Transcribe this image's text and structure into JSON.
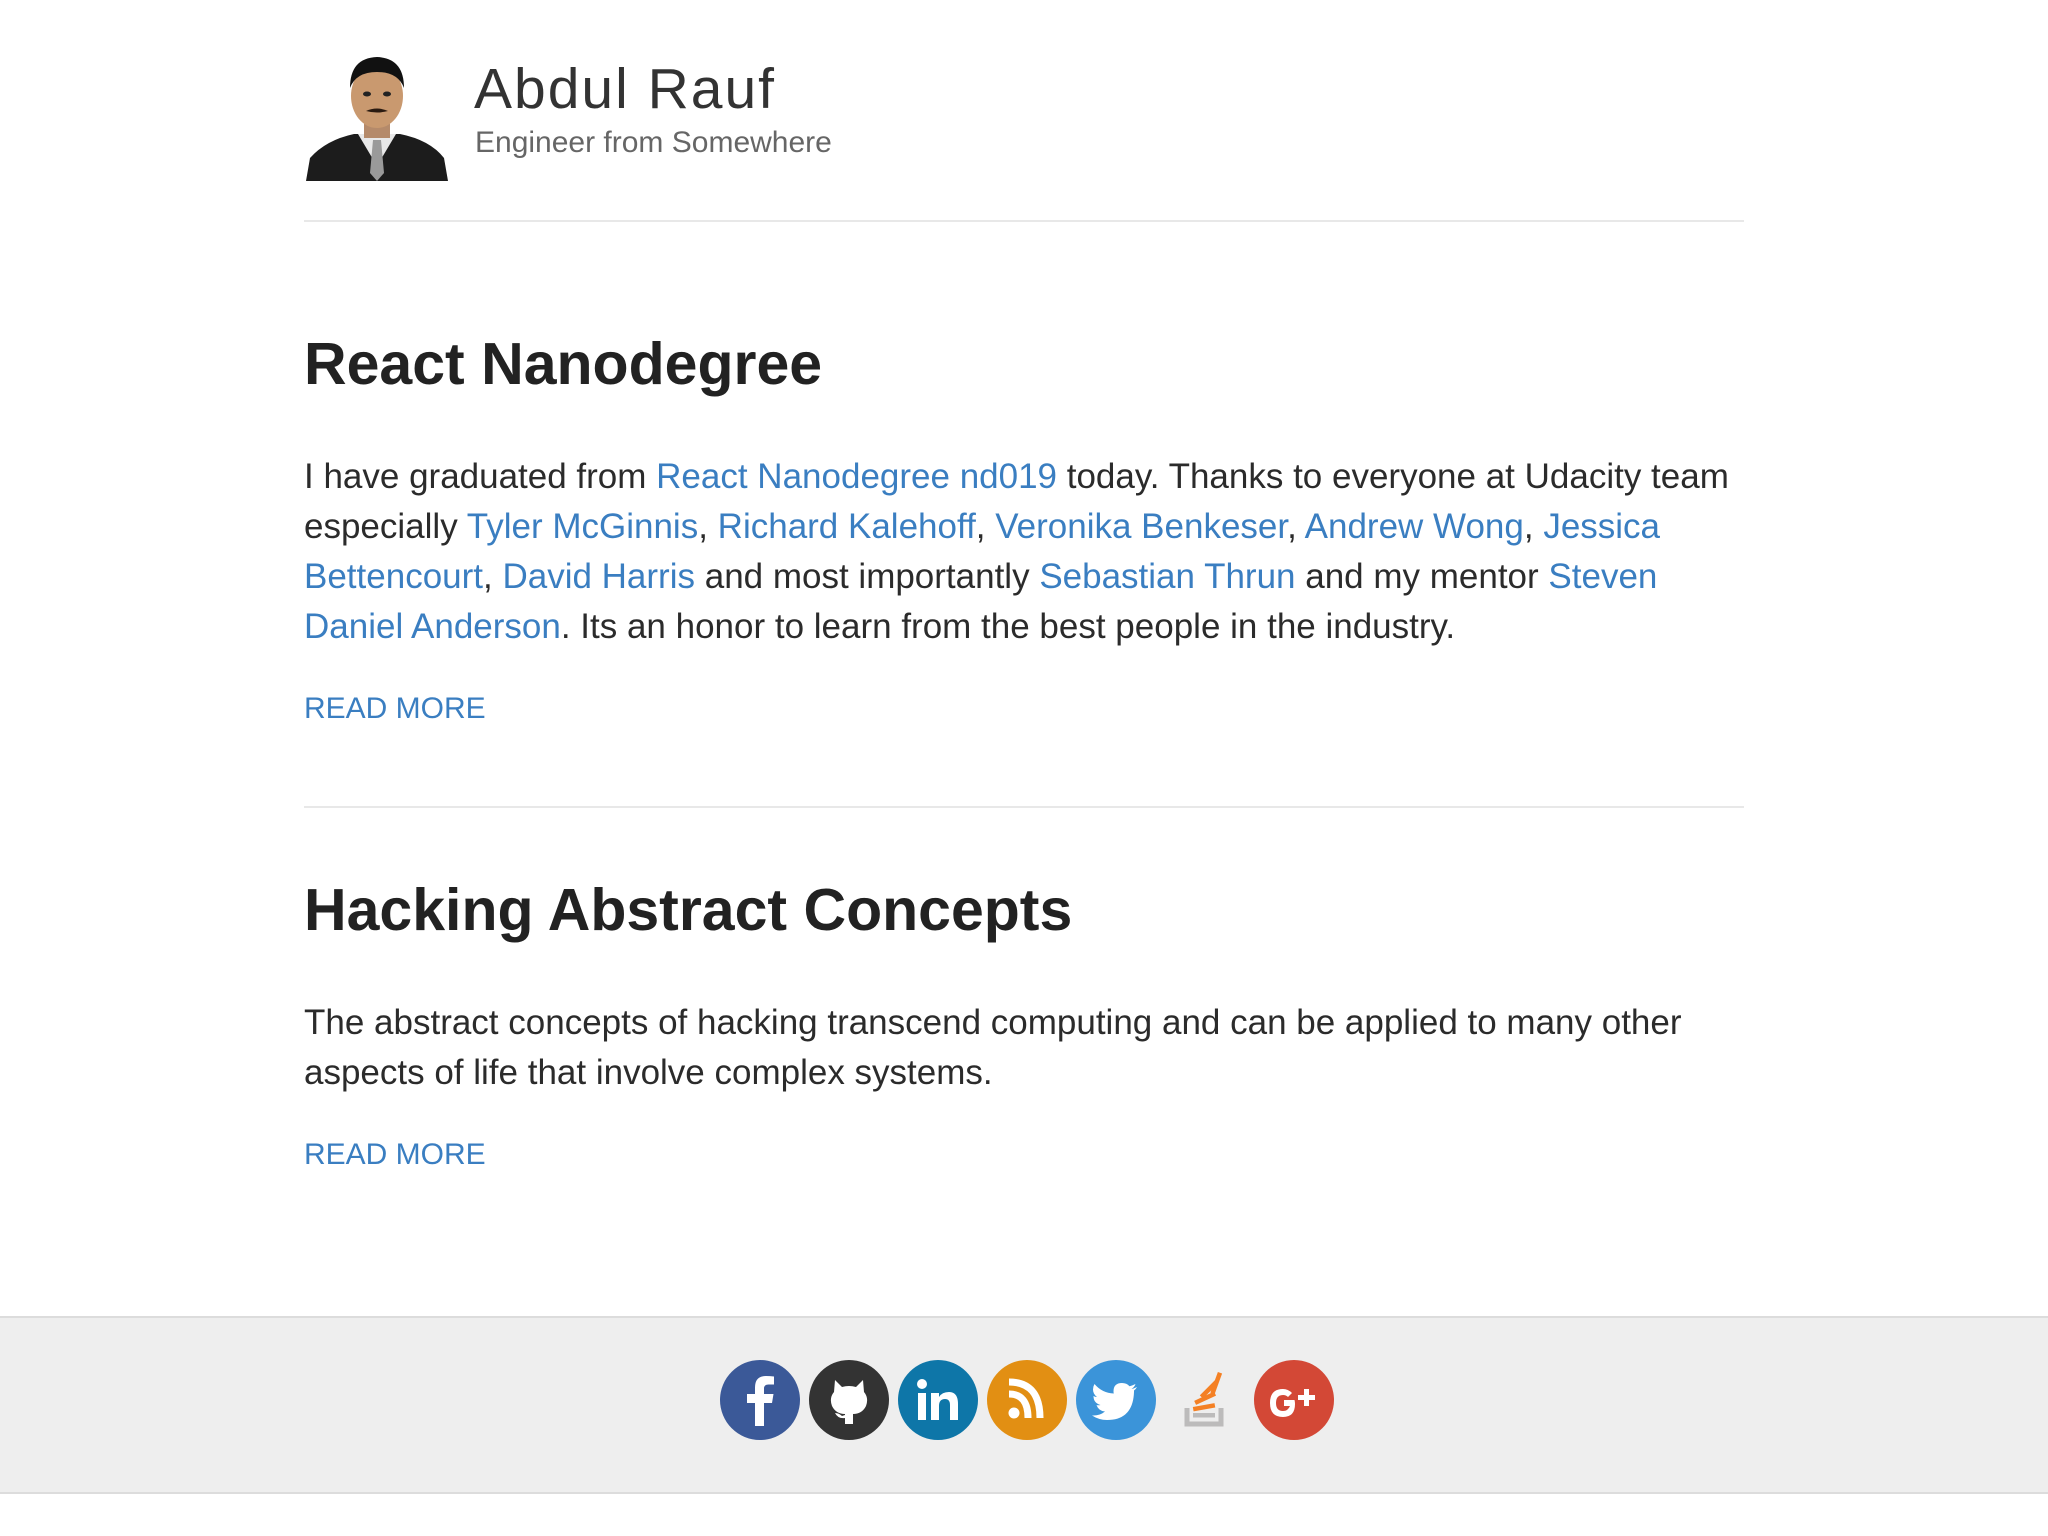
{
  "header": {
    "name": "Abdul Rauf",
    "tagline": "Engineer from Somewhere"
  },
  "posts": [
    {
      "title": "React Nanodegree",
      "body": {
        "t1": "I have graduated from ",
        "link_nd": "React Nanodegree nd019",
        "t2": " today. Thanks to everyone at Udacity team especially ",
        "link_tyler": "Tyler McGinnis",
        "sep1": ", ",
        "link_richard": "Richard Kalehoff",
        "sep2": ", ",
        "link_veronika": "Veronika Benkeser",
        "sep3": ", ",
        "link_andrew": "Andrew Wong",
        "sep4": ", ",
        "link_jessica": "Jessica Bettencourt",
        "sep5": ", ",
        "link_david": "David Harris",
        "t3": " and most importantly ",
        "link_sebastian": "Sebastian Thrun",
        "t4": " and my mentor ",
        "link_steven": "Steven Daniel Anderson",
        "t5": ". Its an honor to learn from the best people in the industry."
      },
      "read_more": "READ MORE"
    },
    {
      "title": "Hacking Abstract Concepts",
      "body": "The abstract concepts of hacking transcend computing and can be applied to many other aspects of life that involve complex systems.",
      "read_more": "READ MORE"
    }
  ],
  "footer": {
    "social": [
      {
        "icon": "facebook-icon",
        "color": "#3b5998"
      },
      {
        "icon": "github-icon",
        "color": "#333333"
      },
      {
        "icon": "linkedin-icon",
        "color": "#0e76a8"
      },
      {
        "icon": "rss-icon",
        "color": "#e28f13"
      },
      {
        "icon": "twitter-icon",
        "color": "#3b94d9"
      },
      {
        "icon": "stackoverflow-icon",
        "color": "#ef8236"
      },
      {
        "icon": "google-plus-icon",
        "color": "#d34836"
      }
    ]
  },
  "colors": {
    "link": "#3a7ec1",
    "text": "#2b2b2b",
    "footer_bg": "#eeeeee"
  }
}
